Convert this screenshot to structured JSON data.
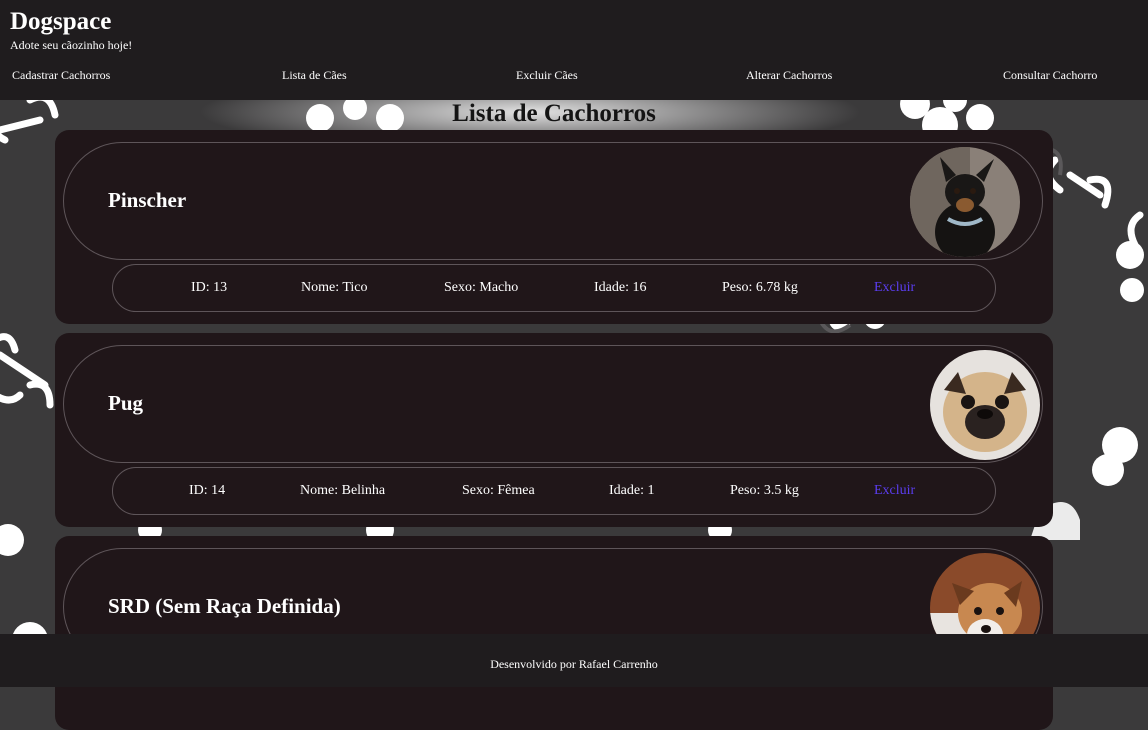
{
  "header": {
    "brand": "Dogspace",
    "tagline": "Adote seu cãozinho hoje!"
  },
  "nav": {
    "items": [
      "Cadastrar Cachorros",
      "Lista de Cães",
      "Excluir Cães",
      "Alterar Cachorros",
      "Consultar Cachorro"
    ]
  },
  "main": {
    "title": "Lista de Cachorros",
    "dogs": [
      {
        "breed": "Pinscher",
        "id": "ID: 13",
        "name": "Nome: Tico",
        "sex": "Sexo: Macho",
        "age": "Idade: 16",
        "weight": "Peso: 6.78 kg",
        "delete_label": "Excluir",
        "photo_icon": "pinscher-photo"
      },
      {
        "breed": "Pug",
        "id": "ID: 14",
        "name": "Nome: Belinha",
        "sex": "Sexo: Fêmea",
        "age": "Idade: 1",
        "weight": "Peso: 3.5 kg",
        "delete_label": "Excluir",
        "photo_icon": "pug-photo"
      },
      {
        "breed": "SRD (Sem Raça Definida)",
        "photo_icon": "srd-photo"
      }
    ]
  },
  "footer": {
    "credit": "Desenvolvido por Rafael Carrenho"
  },
  "colors": {
    "header_bg": "#1f1c1e",
    "card_bg": "#201619",
    "link": "#5b3df0",
    "background": "#3b3a3b"
  }
}
